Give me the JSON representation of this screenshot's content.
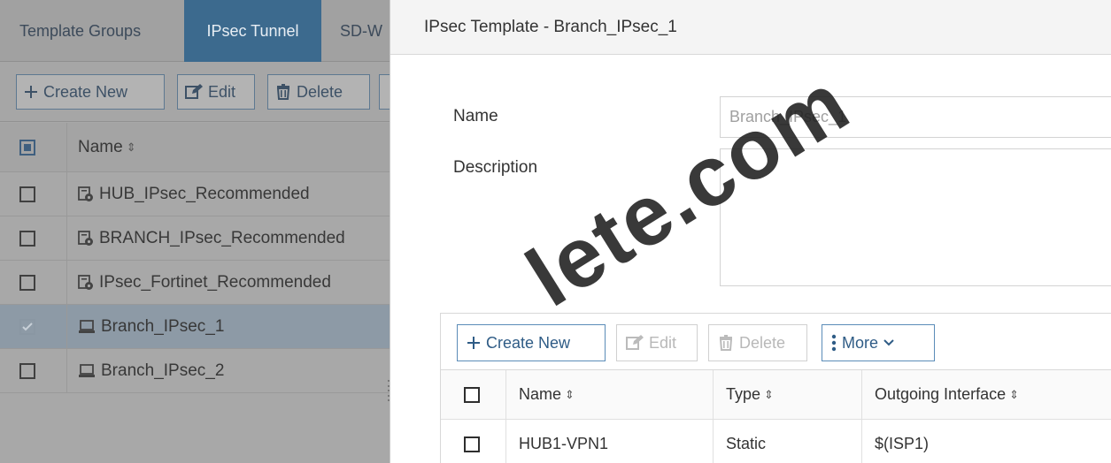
{
  "left_panel": {
    "tabs": [
      {
        "label": "Template Groups"
      },
      {
        "label": "IPsec Tunnel"
      },
      {
        "label": "SD-W"
      }
    ],
    "toolbar": {
      "create_new": "Create New",
      "edit": "Edit",
      "delete": "Delete"
    },
    "table": {
      "header_name": "Name",
      "rows": [
        {
          "name": "HUB_IPsec_Recommended",
          "icon": "template-icon",
          "checked": false
        },
        {
          "name": "BRANCH_IPsec_Recommended",
          "icon": "template-icon",
          "checked": false
        },
        {
          "name": "IPsec_Fortinet_Recommended",
          "icon": "template-icon",
          "checked": false
        },
        {
          "name": "Branch_IPsec_1",
          "icon": "device-icon",
          "checked": true
        },
        {
          "name": "Branch_IPsec_2",
          "icon": "device-icon",
          "checked": false
        }
      ]
    }
  },
  "dialog": {
    "title": "IPsec Template - Branch_IPsec_1",
    "name_label": "Name",
    "name_value": "Branch_IPsec_1",
    "description_label": "Description",
    "description_value": "",
    "toolbar": {
      "create_new": "Create New",
      "edit": "Edit",
      "delete": "Delete",
      "more": "More"
    },
    "table": {
      "headers": {
        "name": "Name",
        "type": "Type",
        "outgoing_interface": "Outgoing Interface"
      },
      "rows": [
        {
          "name": "HUB1-VPN1",
          "type": "Static",
          "outgoing_interface": "$(ISP1)"
        }
      ]
    }
  },
  "sort_glyph": "⇕",
  "watermark": "lete.com",
  "colors": {
    "active_tab": "#3c6a8e",
    "accent_blue": "#2f5c86",
    "dim_overlay": "#a8a8a8"
  }
}
